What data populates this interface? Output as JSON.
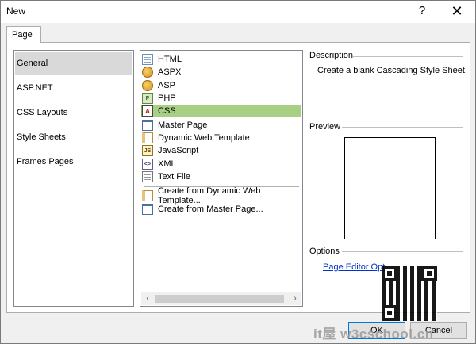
{
  "window": {
    "title": "New",
    "help_glyph": "?",
    "close_glyph": "✕"
  },
  "tabs": [
    {
      "label": "Page"
    }
  ],
  "categories": [
    {
      "label": "General",
      "selected": true
    },
    {
      "label": "ASP.NET"
    },
    {
      "label": "CSS Layouts"
    },
    {
      "label": "Style Sheets"
    },
    {
      "label": "Frames Pages"
    }
  ],
  "templates": [
    {
      "label": "HTML",
      "icon": "html-page-icon"
    },
    {
      "label": "ASPX",
      "icon": "aspx-page-icon"
    },
    {
      "label": "ASP",
      "icon": "asp-page-icon"
    },
    {
      "label": "PHP",
      "icon": "php-page-icon"
    },
    {
      "label": "CSS",
      "icon": "css-page-icon",
      "selected": true
    },
    {
      "label": "Master Page",
      "icon": "master-page-icon"
    },
    {
      "label": "Dynamic Web Template",
      "icon": "dynamic-web-template-icon"
    },
    {
      "label": "JavaScript",
      "icon": "javascript-page-icon"
    },
    {
      "label": "XML",
      "icon": "xml-page-icon"
    },
    {
      "label": "Text File",
      "icon": "text-file-icon"
    }
  ],
  "template_actions": [
    {
      "label": "Create from Dynamic Web Template...",
      "icon": "dynamic-web-template-icon"
    },
    {
      "label": "Create from Master Page...",
      "icon": "master-page-icon"
    }
  ],
  "description": {
    "heading": "Description",
    "text": "Create a blank Cascading Style Sheet."
  },
  "preview": {
    "heading": "Preview"
  },
  "options": {
    "heading": "Options",
    "link": "Page Editor Opti"
  },
  "buttons": {
    "ok": "OK",
    "cancel": "Cancel"
  },
  "watermark": {
    "text": "it屋 w3cschool.cn"
  }
}
